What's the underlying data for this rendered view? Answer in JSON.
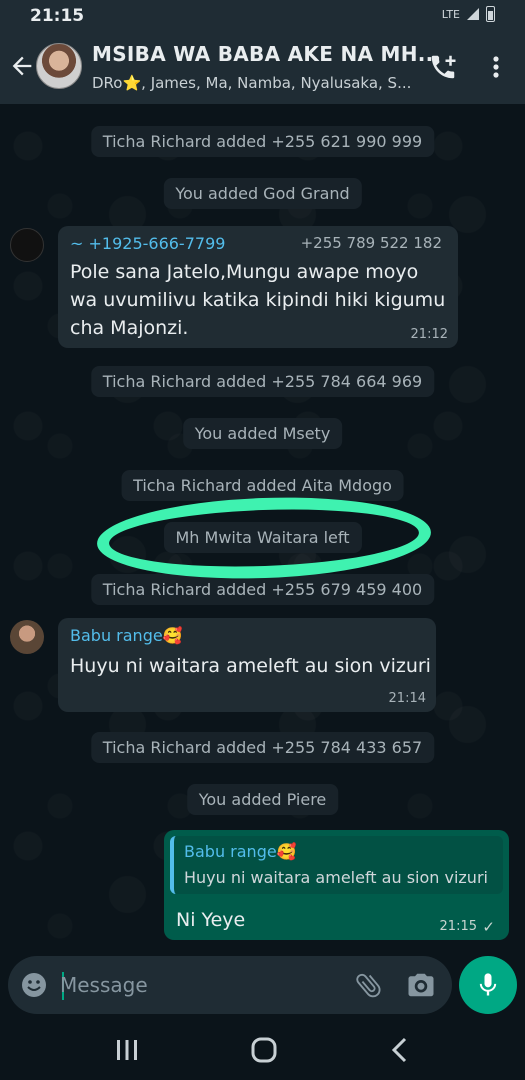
{
  "status_bar": {
    "time": "21:15",
    "network": "LTE"
  },
  "header": {
    "title": "MSIBA WA BABA AKE NA MH...",
    "participants": "DRo⭐, James, Ma, Namba, Nyalusaka, S..."
  },
  "messages": {
    "sys1": "Ticha Richard added +255 621 990 999",
    "sys2": "You added God Grand",
    "msg1": {
      "sender": "~ +1925-666-7799",
      "phone": "+255 789 522 182",
      "text": "Pole sana Jatelo,Mungu awape moyo wa uvumilivu katika kipindi hiki kigumu cha Majonzi.",
      "time": "21:12"
    },
    "sys3": "Ticha Richard added +255 784 664 969",
    "sys4": "You added Msety",
    "sys5": "Ticha Richard added Aita Mdogo",
    "sys6": "Mh Mwita Waitara left",
    "sys7": "Ticha Richard added +255 679 459 400",
    "msg2": {
      "sender": "Babu range🥰",
      "text": "Huyu ni waitara ameleft au sion vizuri",
      "time": "21:14"
    },
    "sys8": "Ticha Richard added +255 784 433 657",
    "sys9": "You added Piere",
    "msg3": {
      "quote_sender": "Babu range🥰",
      "quote_text": "Huyu ni waitara ameleft au sion vizuri",
      "text": "Ni Yeye",
      "time": "21:15",
      "status": "✓"
    }
  },
  "input": {
    "placeholder": "Message"
  },
  "colors": {
    "highlight": "#3ff2b0",
    "accent": "#00a884",
    "outgoing": "#005c4b",
    "incoming": "#202c33"
  }
}
